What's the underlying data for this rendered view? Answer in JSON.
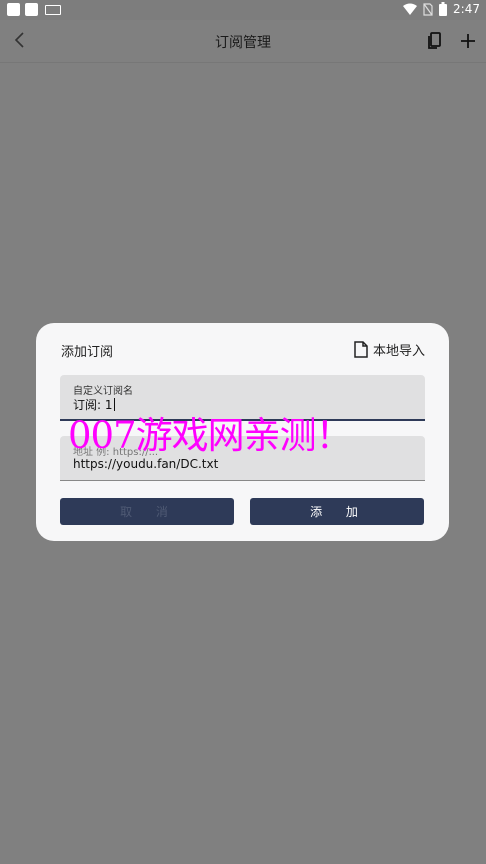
{
  "status_bar": {
    "time": "2:47"
  },
  "app_bar": {
    "title": "订阅管理"
  },
  "dialog": {
    "title": "添加订阅",
    "local_import": "本地导入",
    "name_field": {
      "label": "自定义订阅名",
      "value": "订阅: 1"
    },
    "url_field": {
      "label": "地址 例: https://...",
      "value": "https://youdu.fan/DC.txt"
    },
    "cancel_label": "取 消",
    "add_label": "添 加"
  },
  "watermark": "007游戏网亲测！",
  "colors": {
    "overlay": "#808080",
    "accent": "#2e3a58",
    "watermark": "#ff00ff"
  }
}
